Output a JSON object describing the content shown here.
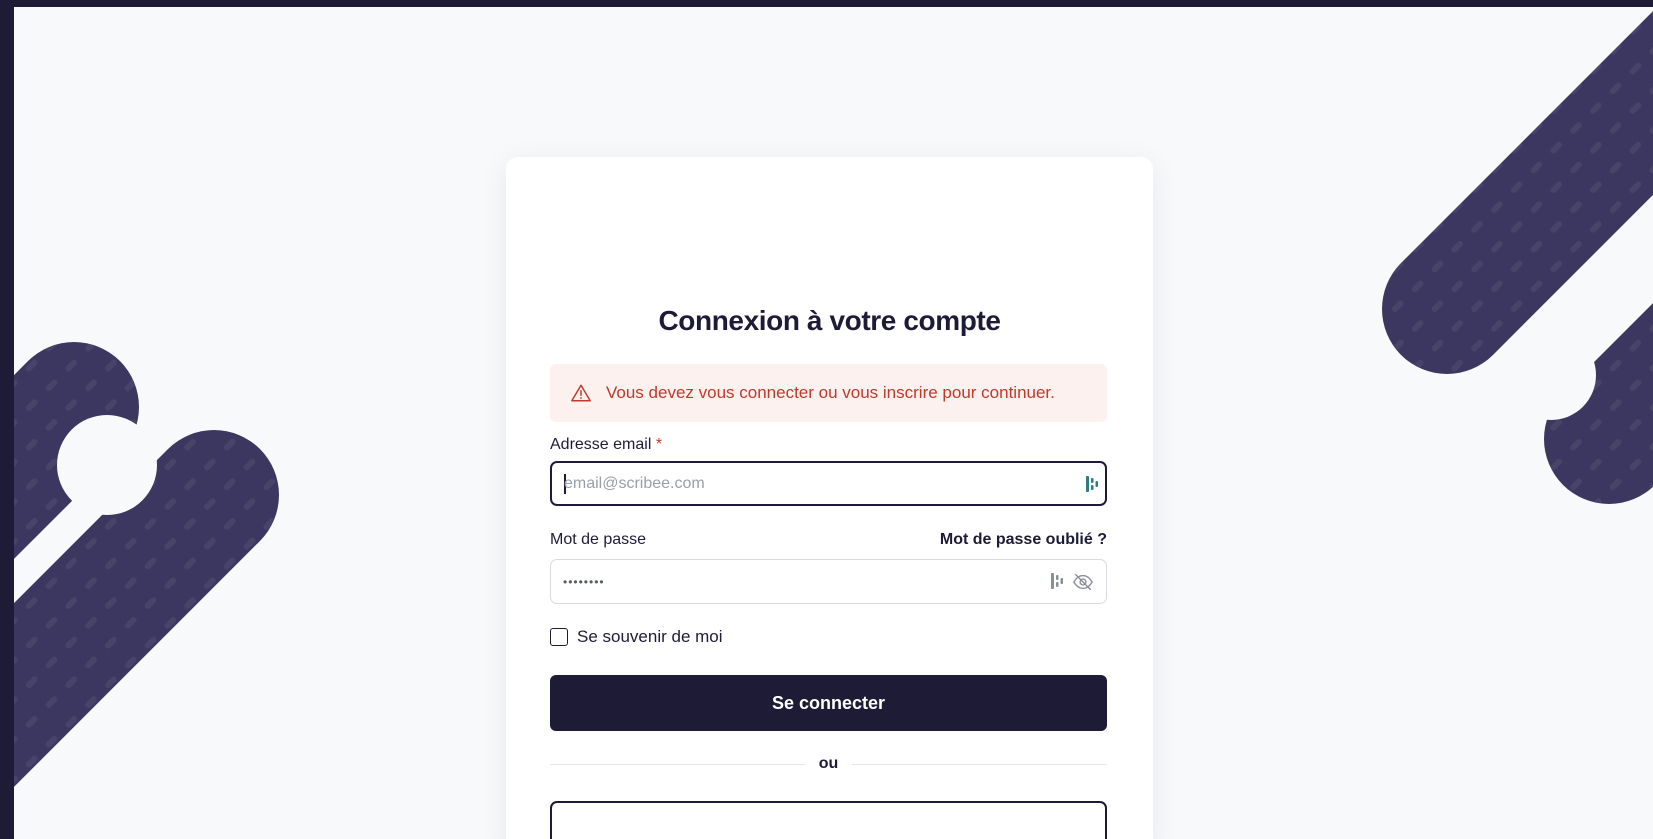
{
  "login": {
    "title": "Connexion à votre compte",
    "alert_message": "Vous devez vous connecter ou vous inscrire pour continuer.",
    "email_label": "Adresse email",
    "required_mark": "*",
    "email_placeholder": "email@scribee.com",
    "email_value": "",
    "password_label": "Mot de passe",
    "forgot_password_link": "Mot de passe oublié ?",
    "password_value": "••••••••",
    "remember_me_label": "Se souvenir de moi",
    "remember_me_checked": false,
    "submit_button": "Se connecter",
    "divider_text": "ou"
  },
  "icons": {
    "alert": "warning-triangle-icon",
    "password_manager": "password-manager-icon",
    "toggle_password": "eye-off-icon"
  },
  "colors": {
    "background": "#1e1b36",
    "page": "#f8f9fb",
    "accent": "#1e1b36",
    "decoration": "#3c3760",
    "alert_bg": "#fdf1ef",
    "alert_text": "#c0392b",
    "required": "#d0342c",
    "pm_icon": "#2f7c86"
  }
}
